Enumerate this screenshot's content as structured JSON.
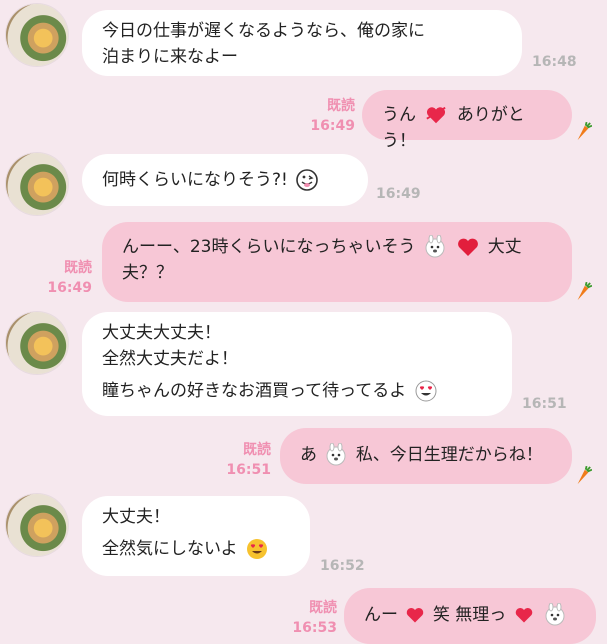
{
  "messages": [
    {
      "side": "left",
      "lines": [
        "今日の仕事が遅くなるようなら、俺の家に",
        "泊まりに来なよー"
      ],
      "time": "16:48"
    },
    {
      "side": "right",
      "read": "既読",
      "time": "16:49",
      "parts": [
        "うん",
        "ありがとう！"
      ]
    },
    {
      "side": "left",
      "parts": [
        "何時くらいになりそう?!"
      ],
      "time": "16:49"
    },
    {
      "side": "right",
      "read": "既読",
      "time": "16:49",
      "parts": [
        "んーー、23時くらいになっちゃいそう",
        "大丈",
        "夫？？"
      ]
    },
    {
      "side": "left",
      "lines": [
        "大丈夫大丈夫！",
        "全然大丈夫だよ！",
        "瞳ちゃんの好きなお酒買って待ってるよ"
      ],
      "time": "16:51"
    },
    {
      "side": "right",
      "read": "既読",
      "time": "16:51",
      "parts": [
        "あ",
        "私、今日生理だからね！"
      ]
    },
    {
      "side": "left",
      "lines": [
        "大丈夫！",
        "全然気にしないよ"
      ],
      "time": "16:52"
    },
    {
      "side": "right",
      "read": "既読",
      "time": "16:53",
      "parts": [
        "んー",
        "笑 無理っ"
      ]
    }
  ],
  "icons": {
    "carrot": "carrot-icon",
    "heart": "heart-icon",
    "bunny": "bunny-face-icon",
    "heart_eyes": "heart-eyes-icon",
    "tongue": "tongue-face-icon"
  },
  "colors": {
    "bg": "#f6e8ee",
    "left_bubble": "#ffffff",
    "right_bubble": "#f7c7d6",
    "read": "#f08fb1",
    "time": "#b6b6b6"
  }
}
